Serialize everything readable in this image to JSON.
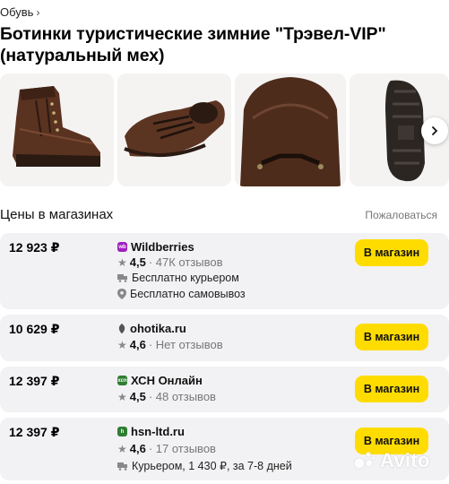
{
  "breadcrumb": {
    "label": "Обувь",
    "chevron": "›"
  },
  "product": {
    "title_line1": "Ботинки туристические зимние \"Трэвел-VIP\"",
    "title_line2": "(натуральный мех)"
  },
  "gallery": {
    "images": [
      "boot-side-view",
      "boot-top-view",
      "boot-toe-closeup",
      "boot-sole-view"
    ],
    "next_icon": "chevron-right-icon"
  },
  "prices_section": {
    "title": "Цены в магазинах",
    "complain_label": "Пожаловаться"
  },
  "offers": [
    {
      "price": "12 923 ₽",
      "shop": "Wildberries",
      "logo_text": "wb",
      "logo_color": "#a020c0",
      "rating": "4,5",
      "reviews": "· 47К отзывов",
      "delivery": [
        "Бесплатно курьером",
        "Бесплатно самовывоз"
      ],
      "button": "В магазин"
    },
    {
      "price": "10 629 ₽",
      "shop": "ohotika.ru",
      "logo_text": "",
      "logo_color": "#555555",
      "rating": "4,6",
      "reviews": "· Нет отзывов",
      "delivery": [],
      "button": "В магазин"
    },
    {
      "price": "12 397 ₽",
      "shop": "ХСН Онлайн",
      "logo_text": "xcn",
      "logo_color": "#2e7d32",
      "rating": "4,5",
      "reviews": "· 48 отзывов",
      "delivery": [],
      "button": "В магазин"
    },
    {
      "price": "12 397 ₽",
      "shop": "hsn-ltd.ru",
      "logo_text": "h",
      "logo_color": "#2e7d32",
      "rating": "4,6",
      "reviews": "· 17 отзывов",
      "delivery": [
        "Курьером, 1 430 ₽, за 7-8 дней"
      ],
      "button": "В магазин"
    }
  ],
  "watermark": {
    "text": "Avito"
  },
  "colors": {
    "button": "#ffdc00",
    "card": "#f2f2f4",
    "star": "#888888"
  }
}
